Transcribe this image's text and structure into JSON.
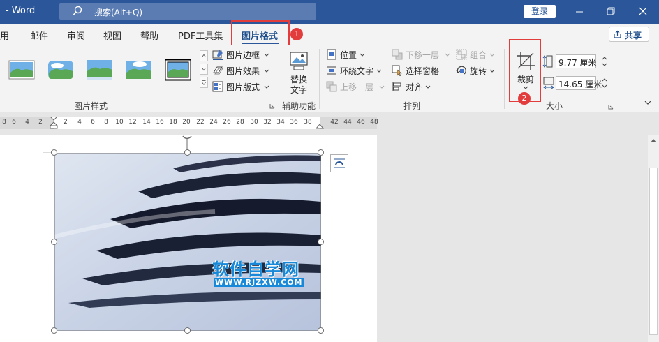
{
  "titlebar": {
    "app_title": "- Word",
    "search_placeholder": "搜索(Alt+Q)",
    "login_label": "登录"
  },
  "tabs": [
    {
      "label": "用"
    },
    {
      "label": "邮件"
    },
    {
      "label": "审阅"
    },
    {
      "label": "视图"
    },
    {
      "label": "帮助"
    },
    {
      "label": "PDF工具集"
    }
  ],
  "active_tab": {
    "label": "图片格式"
  },
  "badges": {
    "first": "1",
    "second": "2"
  },
  "share": {
    "label": "共享"
  },
  "ribbon": {
    "picture_styles": {
      "border": "图片边框",
      "effects": "图片效果",
      "layout": "图片版式",
      "group_label": "图片样式"
    },
    "accessibility": {
      "alt_text_line1": "替换",
      "alt_text_line2": "文字",
      "group_label": "辅助功能"
    },
    "arrange": {
      "position": "位置",
      "wrap_text": "环绕文字",
      "bring_forward": "上移一层",
      "send_backward": "下移一层",
      "selection_pane": "选择窗格",
      "align": "对齐",
      "group": "组合",
      "rotate": "旋转",
      "group_label": "排列"
    },
    "size": {
      "crop_label": "裁剪",
      "height_value": "9.77 厘米",
      "width_value": "14.65 厘米",
      "group_label": "大小"
    }
  },
  "ruler": {
    "left_numbers": [
      "8",
      "6",
      "4",
      "2"
    ],
    "right_numbers": [
      "2",
      "4",
      "6",
      "8",
      "10",
      "12",
      "14",
      "16",
      "18",
      "20",
      "22",
      "24",
      "26",
      "28",
      "30",
      "32",
      "34",
      "36",
      "38"
    ],
    "margin_numbers": [
      "42",
      "44",
      "46",
      "48"
    ]
  },
  "watermark": {
    "text": "软件自学网",
    "url": "WWW.RJZXW.COM"
  },
  "colors": {
    "titlebar": "#2b579a",
    "highlight": "#e23c3c",
    "watermark": "#1789d8"
  }
}
